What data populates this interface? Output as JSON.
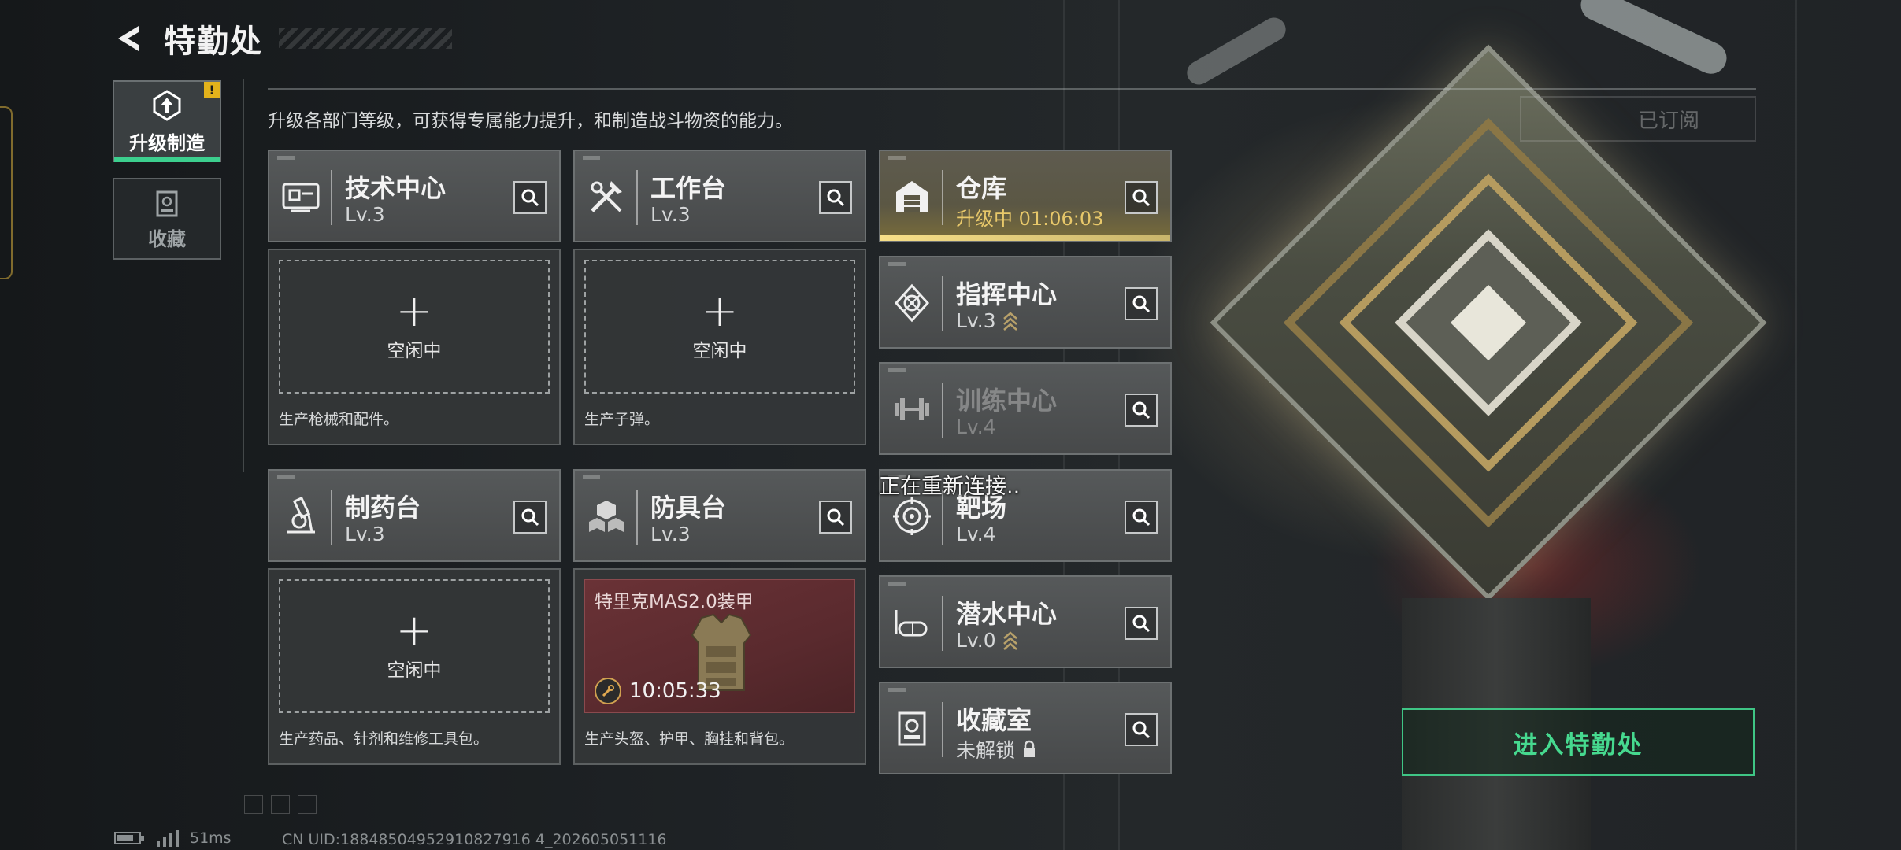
{
  "header": {
    "title": "特勤处"
  },
  "side_tabs": [
    {
      "label": "升级制造",
      "icon": "upgrade-build-icon",
      "alert": "!"
    },
    {
      "label": "收藏",
      "icon": "collection-icon"
    }
  ],
  "subtitle": "升级各部门等级，可获得专属能力提升，和制造战斗物资的能力。",
  "subscribe_label": "已订阅",
  "stations": [
    {
      "name": "技术中心",
      "level": "Lv.3",
      "icon": "tech-center-icon"
    },
    {
      "name": "工作台",
      "level": "Lv.3",
      "icon": "workbench-tools-icon"
    },
    {
      "name": "仓库",
      "level": "升级中 01:06:03",
      "icon": "warehouse-icon",
      "state": "upgrading"
    },
    {
      "name": "指挥中心",
      "level": "Lv.3",
      "icon": "command-center-icon",
      "upgradable": true
    },
    {
      "name": "训练中心",
      "level": "Lv.4",
      "icon": "training-dumbbell-icon"
    },
    {
      "name": "制药台",
      "level": "Lv.3",
      "icon": "microscope-icon"
    },
    {
      "name": "防具台",
      "level": "Lv.3",
      "icon": "armor-blocks-icon"
    },
    {
      "name": "靶场",
      "level": "Lv.4",
      "icon": "target-icon"
    },
    {
      "name": "潜水中心",
      "level": "Lv.0",
      "icon": "diving-mask-icon",
      "upgradable": true
    },
    {
      "name": "收藏室",
      "level": "未解锁",
      "icon": "collection-room-icon",
      "locked": true
    }
  ],
  "slots": [
    {
      "status": "空闲中",
      "desc": "生产枪械和配件。"
    },
    {
      "status": "空闲中",
      "desc": "生产子弹。"
    },
    {
      "status": "空闲中",
      "desc": "生产药品、针剂和维修工具包。"
    },
    {
      "item": "特里克MAS2.0装甲",
      "timer": "10:05:33",
      "desc": "生产头盔、护甲、胸挂和背包。"
    }
  ],
  "reconnect_text": "正在重新连接..",
  "enter_button": "进入特勤处",
  "status_bar": {
    "ping": "51ms",
    "uid": "CN UID:18848504952910827916 4_202605051116"
  },
  "colors": {
    "accent_green": "#46d98f",
    "upgrade_gold": "#e8c86a",
    "alert_yellow": "#e3b21b",
    "armor_red": "#5a2a2e"
  }
}
